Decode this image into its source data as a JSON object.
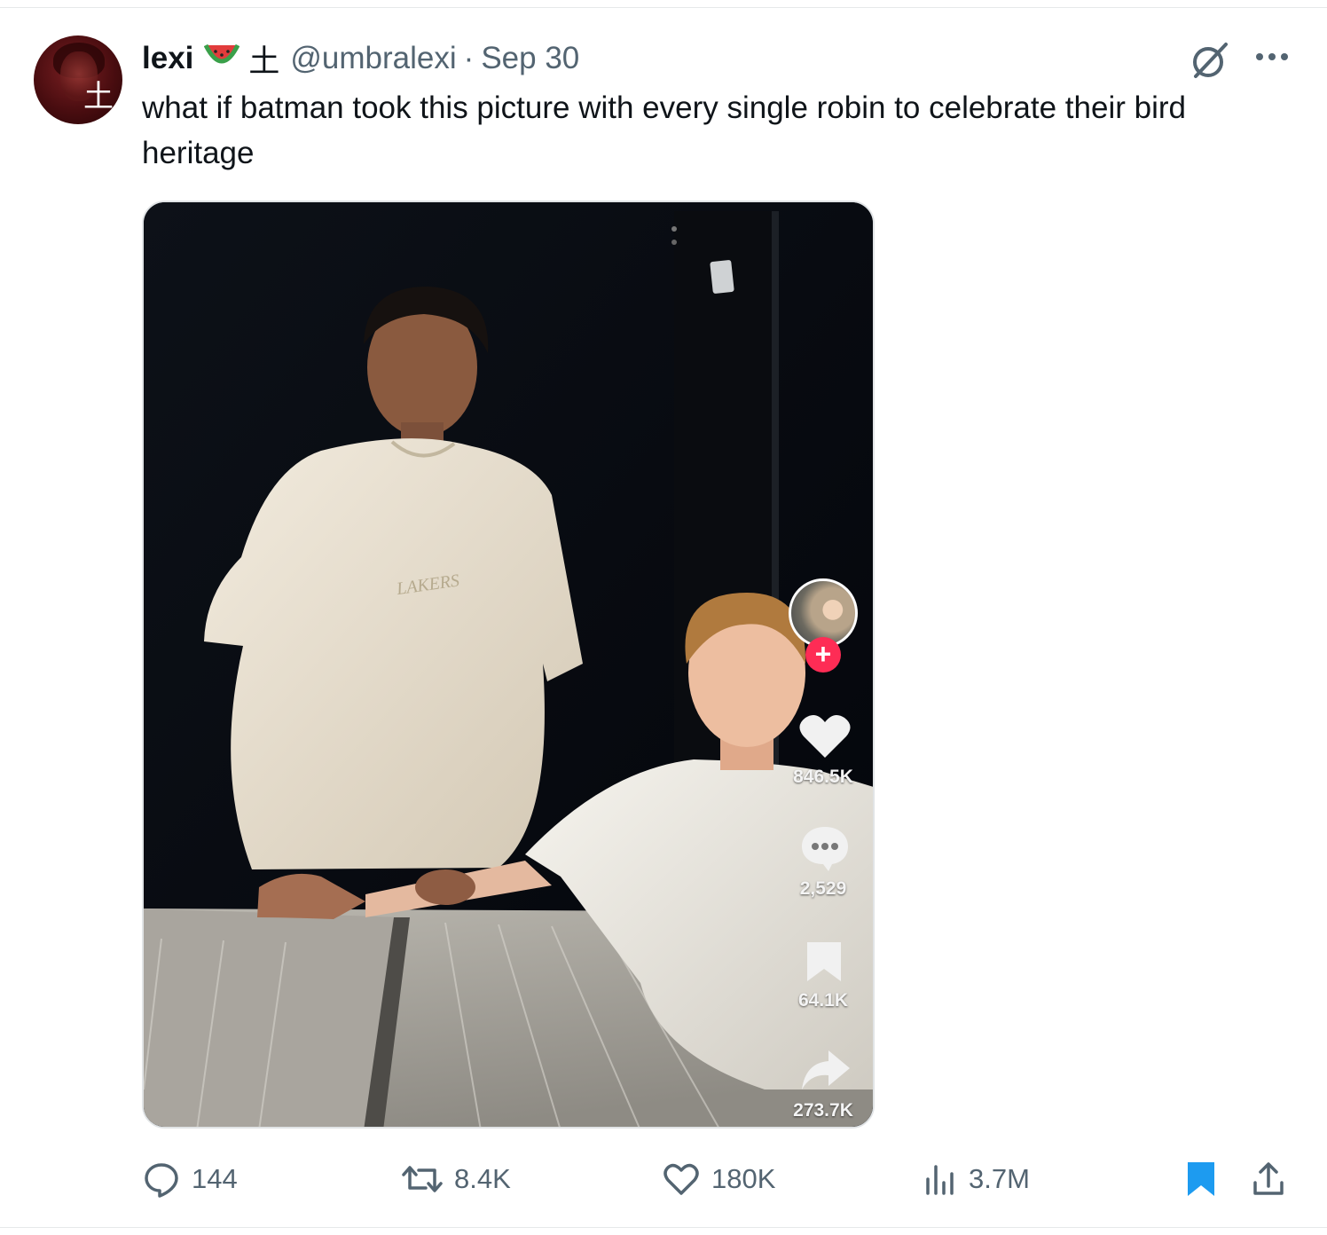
{
  "tweet": {
    "author_name": "lexi",
    "emoji": "🍉",
    "name_glyph": "土",
    "handle": "@umbralexi",
    "separator": "·",
    "date": "Sep 30",
    "text": "what if batman took this picture with every single robin to celebrate their bird heritage",
    "avatar_glyph": "土"
  },
  "media": {
    "shirt_logo": "LAKERS",
    "tiktok": {
      "follow": "+",
      "likes": "846.5K",
      "comments": "2,529",
      "saves": "64.1K",
      "shares": "273.7K"
    }
  },
  "actions": {
    "replies": "144",
    "reposts": "8.4K",
    "likes": "180K",
    "views": "3.7M"
  },
  "colors": {
    "text": "#0f1419",
    "secondary": "#536471",
    "bookmark_active": "#1d9bf0",
    "tiktok_red": "#fe2c55"
  },
  "icons": [
    "grok-icon",
    "more-icon",
    "reply-icon",
    "repost-icon",
    "like-icon",
    "views-icon",
    "bookmark-icon",
    "share-icon"
  ]
}
